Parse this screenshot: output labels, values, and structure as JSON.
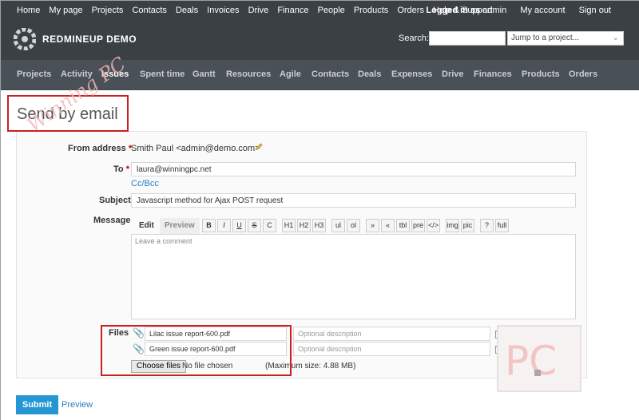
{
  "top_menu": {
    "left_items": [
      "Home",
      "My page",
      "Projects",
      "Contacts",
      "Deals",
      "Invoices",
      "Drive",
      "Finance",
      "People",
      "Products",
      "Orders",
      "Help & Support"
    ],
    "logged_in_prefix": "Logged in as",
    "logged_in_user": "admin",
    "my_account": "My account",
    "sign_out": "Sign out"
  },
  "header": {
    "title": "REDMINEUP DEMO",
    "search_label": "Search:",
    "search_value": "",
    "project_jump": "Jump to a project..."
  },
  "main_menu": {
    "items": [
      "Projects",
      "Activity",
      "Issues",
      "Spent time",
      "Gantt",
      "Resources",
      "Agile",
      "Contacts",
      "Deals",
      "Expenses",
      "Drive",
      "Finances",
      "Products",
      "Orders"
    ],
    "selected": "Issues"
  },
  "page": {
    "title": "Send by email"
  },
  "form": {
    "from_label": "From address",
    "from_value": "Smith Paul <admin@demo.com>",
    "to_label": "To",
    "to_value": "laura@winningpc.net",
    "cc_bcc": "Cc/Bcc",
    "subject_label": "Subject",
    "subject_value": "Javascript method for Ajax POST request",
    "message_label": "Message",
    "tab_edit": "Edit",
    "tab_preview": "Preview",
    "toolbar": [
      "B",
      "I",
      "U",
      "S",
      "C",
      "H1",
      "H2",
      "H3",
      "ul",
      "ol",
      "»",
      "«",
      "tbl",
      "pre",
      "</>",
      "img",
      "pic",
      "?",
      "full"
    ],
    "message_placeholder": "Leave a comment",
    "files_label": "Files",
    "files": [
      {
        "name": "Lilac issue report-600.pdf",
        "description_placeholder": "Optional description"
      },
      {
        "name": "Green issue report-600.pdf",
        "description_placeholder": "Optional description"
      }
    ],
    "choose_files": "Choose files",
    "no_file": "No file chosen",
    "max_size": "(Maximum size: 4.88 MB)",
    "submit": "Submit",
    "preview": "Preview"
  },
  "colors": {
    "header_bg": "#3b4045",
    "menu_bg": "#4a5057",
    "highlight_box": "#cc1f1f",
    "link": "#2a7fc1",
    "submit": "#2496d4"
  }
}
